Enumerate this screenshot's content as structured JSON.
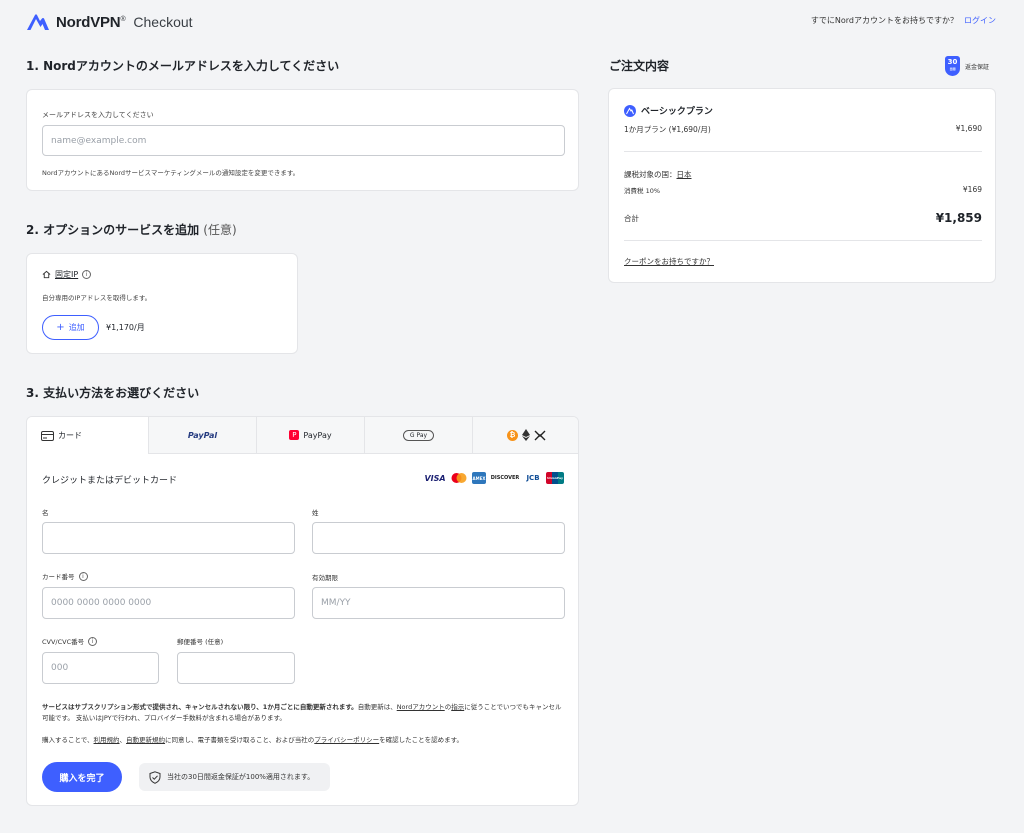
{
  "header": {
    "brand": "NordVPN",
    "brand_mark": "®",
    "subtitle": "Checkout",
    "account_prompt": "すでにNordアカウントをお持ちですか？",
    "login_link": "ログイン"
  },
  "section1": {
    "title": "1. Nordアカウントのメールアドレスを入力してください",
    "email_label": "メールアドレスを入力してください",
    "email_placeholder": "name@example.com",
    "email_note": "NordアカウントにあるNordサービスマーケティングメールの通知設定を変更できます。"
  },
  "section2": {
    "title": "2. オプションのサービスを追加",
    "title_optional": "(任意)",
    "addon": {
      "icon": "home-icon",
      "name": "固定IP",
      "description": "自分専用のIPアドレスを取得します。",
      "add_label": "追加",
      "price": "¥1,170/月"
    }
  },
  "section3": {
    "title": "3. 支払い方法をお選びください",
    "tabs": [
      {
        "label": "カード",
        "icon": "credit-card-icon"
      },
      {
        "label": "PayPal",
        "icon": "paypal-icon"
      },
      {
        "label": "PayPay",
        "icon": "paypay-icon"
      },
      {
        "label": "G Pay",
        "icon": "google-pay-icon"
      },
      {
        "label": "",
        "icon": "crypto-icon"
      }
    ],
    "card_heading": "クレジットまたはデビットカード",
    "brands": [
      "VISA",
      "Mastercard",
      "AMEX",
      "DISCOVER",
      "JCB",
      "UnionPay"
    ],
    "fields": {
      "first_name_label": "名",
      "last_name_label": "姓",
      "card_number_label": "カード番号",
      "card_number_placeholder": "0000 0000 0000 0000",
      "expiry_label": "有効期限",
      "expiry_placeholder": "MM/YY",
      "cvv_label": "CVV/CVC番号",
      "cvv_placeholder": "000",
      "postal_label": "郵便番号 (任意)"
    },
    "terms": {
      "bold": "サービスはサブスクリプション形式で提供され、キャンセルされない限り、1か月ごとに自動更新されます。",
      "part1": "自動更新は、",
      "link1": "Nordアカウント",
      "part2": "の",
      "link2": "指示",
      "part3": "に従うことでいつでもキャンセル可能です。 支払いはJPYで行われ、プロバイダー手数料が含まれる場合があります。"
    },
    "consent": {
      "part1": "購入することで、",
      "link1": "利用規約",
      "sep1": "、",
      "link2": "自動更新規約",
      "part2": "に同意し、電子書類を受け取ること、および当社の",
      "link3": "プライバシーポリシー",
      "part3": "を確認したことを認めます。"
    },
    "buy_button": "購入を完了",
    "guarantee_text": "当社の30日間返金保証が100%適用されます。"
  },
  "summary": {
    "title": "ご注文内容",
    "badge_number": "30",
    "badge_caption": "返金保証",
    "plan_name": "ベーシックプラン",
    "plan_term": "1か月プラン (¥1,690/月)",
    "plan_price": "¥1,690",
    "tax_country_label": "課税対象の国：",
    "tax_country": "日本",
    "tax_label": "消費税 10%",
    "tax_amount": "¥169",
    "total_label": "合計",
    "total_amount": "¥1,859",
    "coupon_link": "クーポンをお持ちですか？"
  },
  "colors": {
    "accent": "#3e5fff",
    "background": "#f3f4f6"
  }
}
